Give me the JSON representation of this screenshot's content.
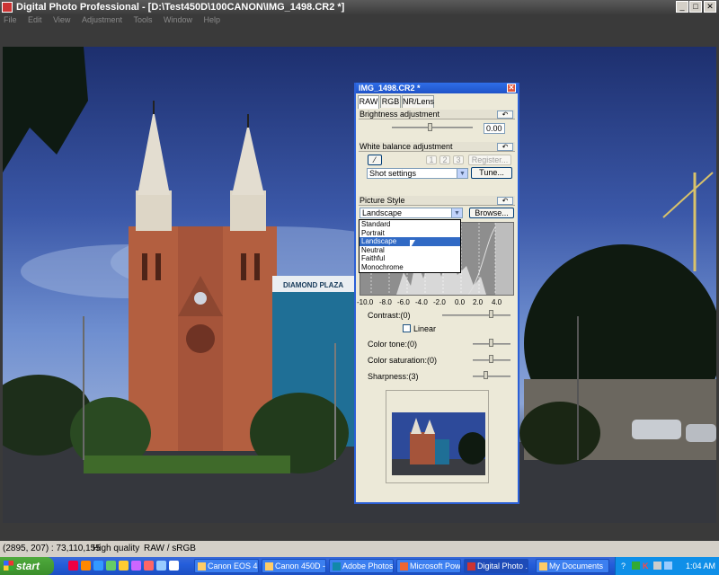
{
  "window": {
    "title": "Digital Photo Professional - [D:\\Test450D\\100CANON\\IMG_1498.CR2 *]"
  },
  "menu": [
    "File",
    "Edit",
    "View",
    "Adjustment",
    "Tools",
    "Window",
    "Help"
  ],
  "image": {
    "building_sign": "DIAMOND PLAZA"
  },
  "palette": {
    "title": "IMG_1498.CR2 *",
    "tabs": [
      "RAW",
      "RGB",
      "NR/Lens"
    ],
    "brightness": {
      "label": "Brightness adjustment",
      "value": "0.00"
    },
    "white_balance": {
      "label": "White balance adjustment",
      "steps": [
        "1",
        "2",
        "3"
      ],
      "register": "Register...",
      "select": "Shot settings",
      "tune": "Tune..."
    },
    "picture_style": {
      "label": "Picture Style",
      "select": "Landscape",
      "browse": "Browse...",
      "options": [
        "Standard",
        "Portrait",
        "Landscape",
        "Neutral",
        "Faithful",
        "Monochrome"
      ],
      "highlighted": "Landscape",
      "axis": [
        "-10.0",
        "-8.0",
        "-6.0",
        "-4.0",
        "-2.0",
        "0.0",
        "2.0",
        "4.0"
      ],
      "contrast": "Contrast:(0)",
      "linear": "Linear",
      "color_tone": "Color tone:(0)",
      "saturation": "Color saturation:(0)",
      "sharpness": "Sharpness:(3)"
    }
  },
  "status": {
    "coords": "(2895, 207) : 73,110,155",
    "quality": "High quality",
    "mode": "RAW / sRGB"
  },
  "taskbar": {
    "start": "start",
    "tasks": [
      "Canon EOS 4...",
      "Canon 450D -...",
      "Adobe Photos...",
      "Microsoft Pow...",
      "Digital Photo ...",
      "My Documents"
    ],
    "tray_letters": [
      "?",
      "K"
    ],
    "clock": "1:04 AM"
  },
  "colors": {
    "titlebar": "#3c3c3c",
    "accent": "#2b5fd6",
    "highlight": "#316ac5"
  }
}
